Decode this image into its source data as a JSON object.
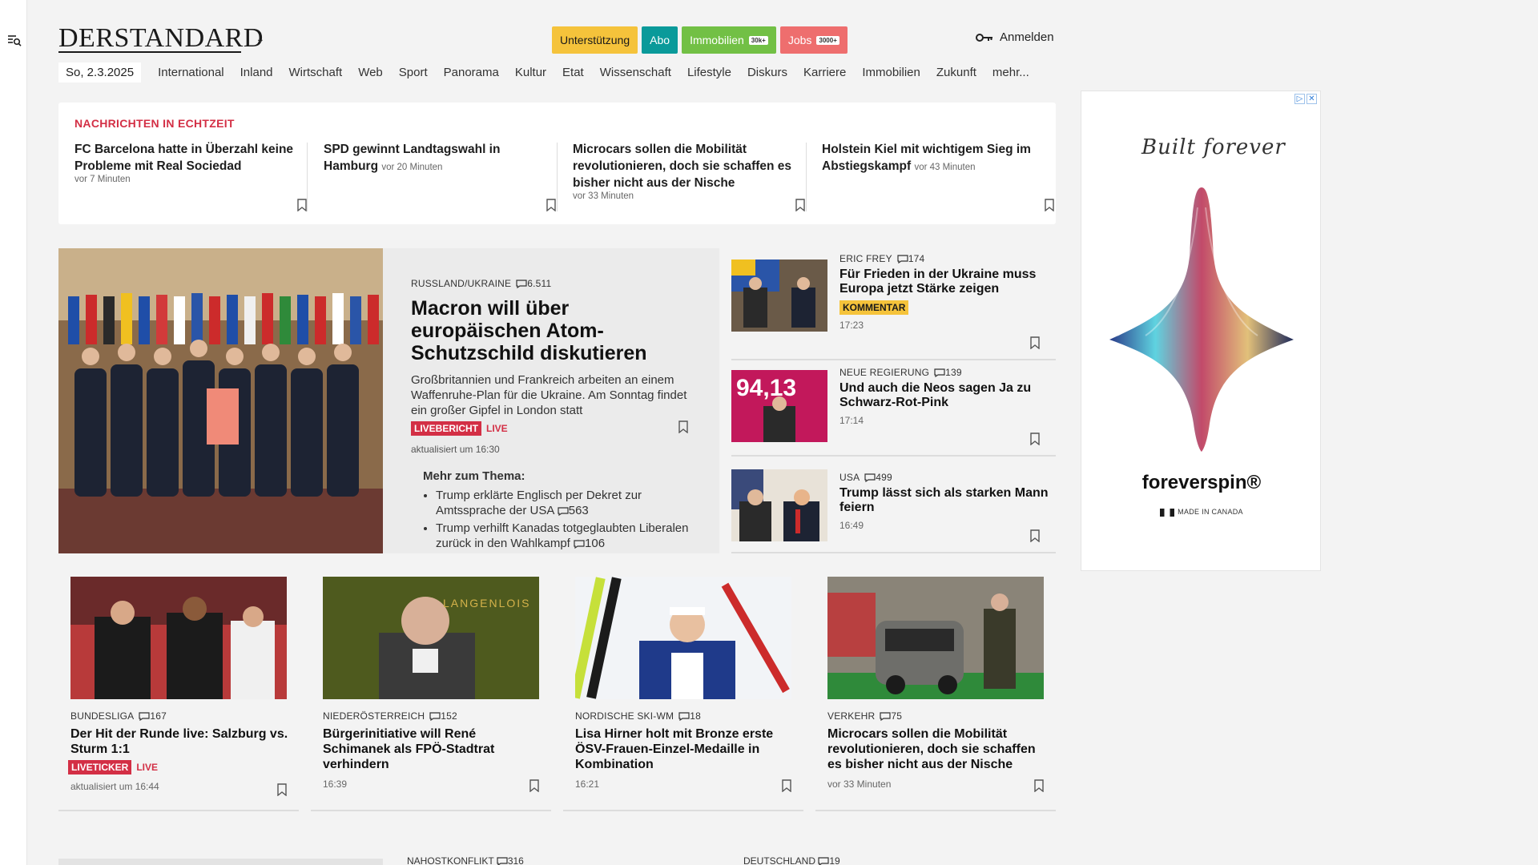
{
  "header": {
    "logo": "DERSTANDARD",
    "buttons": [
      {
        "label": "Unterstützung",
        "bg": "#f5c33b",
        "fg": "#1a1a1a"
      },
      {
        "label": "Abo",
        "bg": "#0a9a9a",
        "fg": "#ffffff"
      },
      {
        "label": "Immobilien",
        "sub": "30k+",
        "bg": "#72c045",
        "fg": "#ffffff"
      },
      {
        "label": "Jobs",
        "sub": "3000+",
        "bg": "#ee6e6e",
        "fg": "#ffffff"
      }
    ],
    "login": "Anmelden"
  },
  "nav": {
    "date": "So, 2.3.2025",
    "items": [
      "International",
      "Inland",
      "Wirtschaft",
      "Web",
      "Sport",
      "Panorama",
      "Kultur",
      "Etat",
      "Wissenschaft",
      "Lifestyle",
      "Diskurs",
      "Karriere",
      "Immobilien",
      "Zukunft",
      "mehr..."
    ]
  },
  "ticker": {
    "heading": "NACHRICHTEN IN ECHTZEIT",
    "items": [
      {
        "title": "FC Barcelona hatte in Überzahl keine Probleme mit Real Sociedad",
        "ago": "vor 7 Minuten"
      },
      {
        "title": "SPD gewinnt Landtagswahl in Hamburg",
        "ago": "vor 20 Minuten"
      },
      {
        "title": "Microcars sollen die Mobilität revolutionieren, doch sie schaffen es bisher nicht aus der Nische",
        "ago": "vor 33 Minuten"
      },
      {
        "title": "Holstein Kiel mit wichtigem Sieg im Abstiegskampf",
        "ago": "vor 43 Minuten"
      }
    ]
  },
  "lead": {
    "kicker": "RUSSLAND/UKRAINE",
    "comments": "6.511",
    "title": "Macron will über europäischen Atom-Schutzschild diskutieren",
    "teaser": "Großbritannien und Frankreich arbeiten an einem Waffenruhe-Plan für die Ukraine. Am Sonntag findet ein großer Gipfel in London statt",
    "tag": "LIVEBERICHT",
    "live": "LIVE",
    "updated": "aktualisiert um 16:30",
    "more_heading": "Mehr zum Thema:",
    "more": [
      {
        "text": "Trump erklärte Englisch per Dekret zur Amtssprache der USA",
        "comments": "563"
      },
      {
        "text": "Trump verhilft Kanadas totgeglaubten Liberalen zurück in den Wahlkampf",
        "comments": "106"
      }
    ]
  },
  "side": [
    {
      "kicker": "ERIC FREY",
      "comments": "174",
      "title": "Für Frieden in der Ukraine muss Europa jetzt Stärke zeigen",
      "tag": "KOMMENTAR",
      "time": "17:23"
    },
    {
      "kicker": "NEUE REGIERUNG",
      "comments": "139",
      "title": "Und auch die Neos sagen Ja zu Schwarz-Rot-Pink",
      "time": "17:14",
      "thumb_text": "94,13"
    },
    {
      "kicker": "USA",
      "comments": "499",
      "title": "Trump lässt sich als starken Mann feiern",
      "time": "16:49"
    }
  ],
  "cards": [
    {
      "kicker": "BUNDESLIGA",
      "comments": "167",
      "title": "Der Hit der Runde live: Salzburg vs. Sturm 1:1",
      "tag": "LIVETICKER",
      "live": "LIVE",
      "time": "aktualisiert um 16:44"
    },
    {
      "kicker": "NIEDERÖSTERREICH",
      "comments": "152",
      "title": "Bürgerinitiative will René Schimanek als FPÖ-Stadtrat verhindern",
      "time": "16:39",
      "img_text": "LANGENLOIS"
    },
    {
      "kicker": "NORDISCHE SKI-WM",
      "comments": "18",
      "title": "Lisa Hirner holt mit Bronze erste ÖSV-Frauen-Einzel-Medaille in Kombination",
      "time": "16:21"
    },
    {
      "kicker": "VERKEHR",
      "comments": "75",
      "title": "Microcars sollen die Mobilität revolutionieren, doch sie schaffen es bisher nicht aus der Nische",
      "time": "vor 33 Minuten"
    }
  ],
  "ad": {
    "slogan": "Built forever",
    "brand": "foreverspin®",
    "made": "MADE IN CANADA"
  },
  "peek": [
    {
      "kicker": "NAHOSTKONFLIKT",
      "comments": "316"
    },
    {
      "kicker": "DEUTSCHLAND",
      "comments": "19"
    }
  ]
}
